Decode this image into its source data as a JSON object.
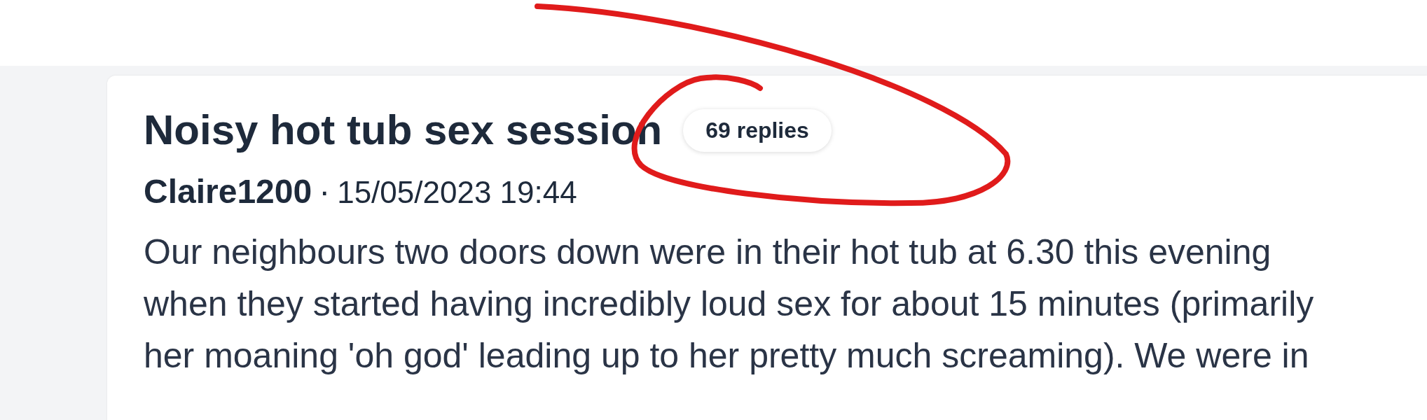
{
  "thread": {
    "title": "Noisy hot tub sex session",
    "reply_count": "69 replies",
    "author": "Claire1200",
    "separator": "·",
    "timestamp": "15/05/2023 19:44",
    "body": "Our neighbours two doors down were in their hot tub at 6.30 this evening when they started having incredibly loud sex for about 15 minutes (primarily her moaning 'oh god' leading up to her pretty much screaming). We were in"
  }
}
